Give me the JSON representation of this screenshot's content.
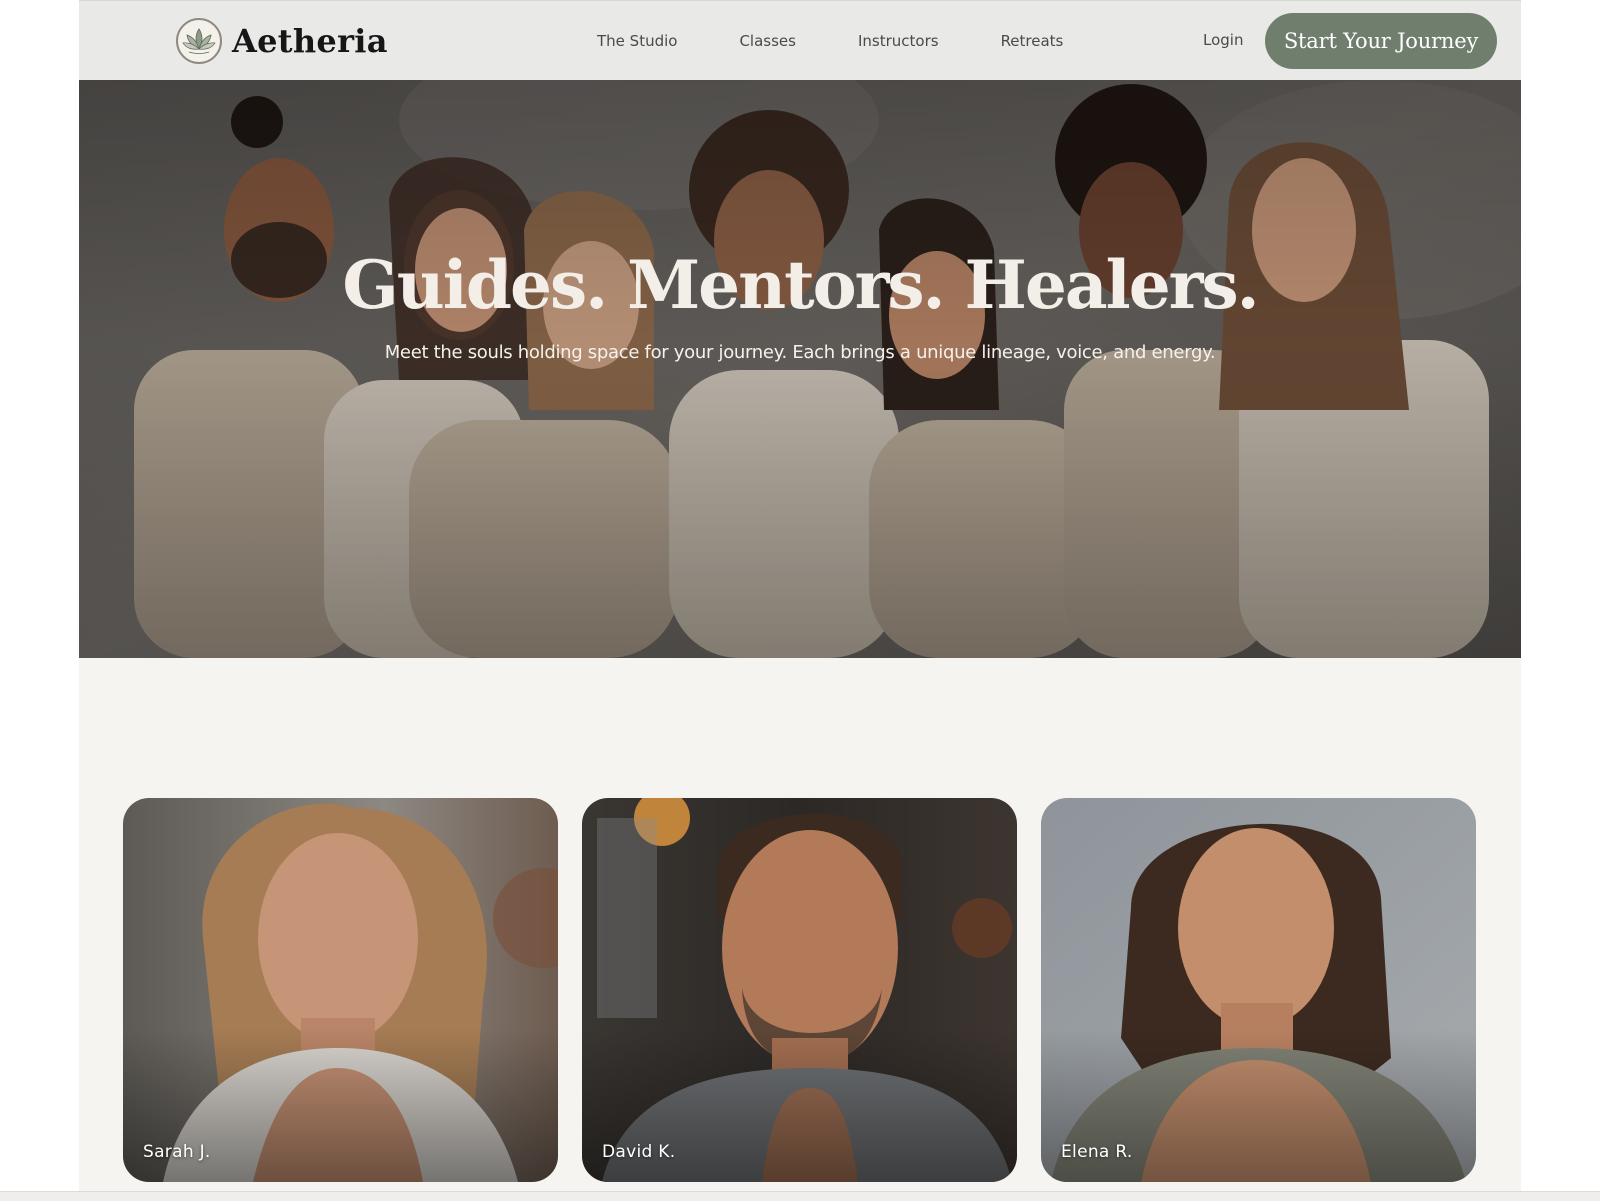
{
  "brand": {
    "name": "Aetheria",
    "logo_icon": "lotus-icon"
  },
  "nav": {
    "links": [
      "The Studio",
      "Classes",
      "Instructors",
      "Retreats"
    ],
    "login_label": "Login",
    "cta_label": "Start Your Journey"
  },
  "hero": {
    "title": "Guides. Mentors. Healers.",
    "subtitle": "Meet the souls holding space for your journey. Each brings a unique lineage, voice, and energy."
  },
  "instructors": [
    {
      "name": "Sarah J."
    },
    {
      "name": "David K."
    },
    {
      "name": "Elena R."
    }
  ],
  "colors": {
    "accent": "#707f6d",
    "nav_background": "#e9e9e8",
    "page_background": "#f5f4f1",
    "heading_text": "#161616",
    "hero_text": "#f3efe8"
  }
}
